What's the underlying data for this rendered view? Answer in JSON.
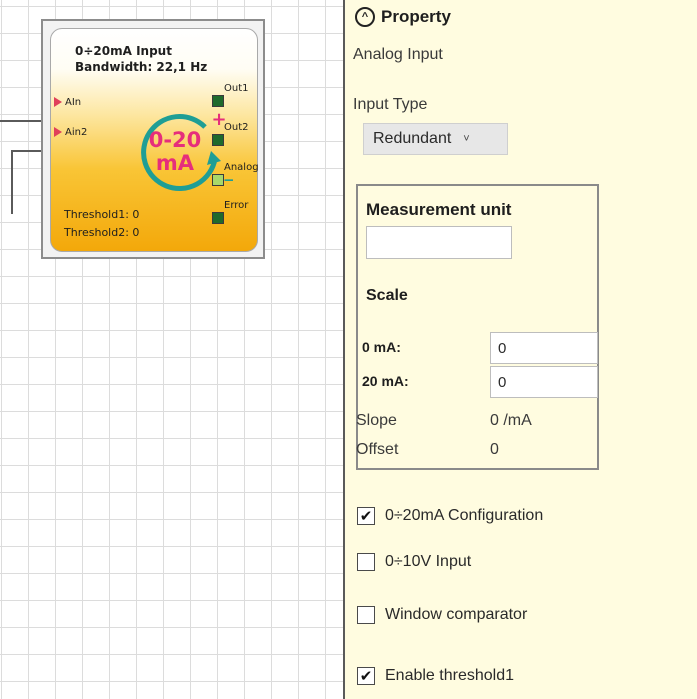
{
  "block": {
    "title": "0÷20mA Input",
    "bandwidth": "Bandwidth: 22,1 Hz",
    "inputs": [
      "AIn",
      "Ain2"
    ],
    "outputs": [
      "Out1",
      "Out2",
      "Analog",
      "Error"
    ],
    "threshold1": "Threshold1: 0",
    "threshold2": "Threshold2: 0",
    "logo_top": "0-20",
    "logo_bottom": "mA",
    "logo_plus": "+",
    "logo_minus": "_",
    "colors": {
      "accent_teal": "#1f9e95",
      "logo_text": "#e62e7b",
      "output_port": "#1f6a2c",
      "analog_port": "#a8d86a",
      "input_arrow": "#e0405a"
    }
  },
  "panel": {
    "header": "Property",
    "chevron": "^",
    "subtitle": "Analog Input",
    "input_type_label": "Input Type",
    "input_type_value": "Redundant",
    "dropdown_caret": "˅",
    "measurement_unit_label": "Measurement unit",
    "measurement_unit_value": "",
    "scale_label": "Scale",
    "zero_ma_label": "0 mA:",
    "zero_ma_value": "0",
    "twenty_ma_label": "20 mA:",
    "twenty_ma_value": "0",
    "slope_label": "Slope",
    "slope_value": "0 /mA",
    "offset_label": "Offset",
    "offset_value": "0",
    "check_mark": "✔",
    "checkboxes": [
      {
        "label": "0÷20mA Configuration",
        "checked": true
      },
      {
        "label": "0÷10V Input",
        "checked": false
      },
      {
        "label": "Window comparator",
        "checked": false
      },
      {
        "label": "Enable threshold1",
        "checked": true
      }
    ]
  }
}
